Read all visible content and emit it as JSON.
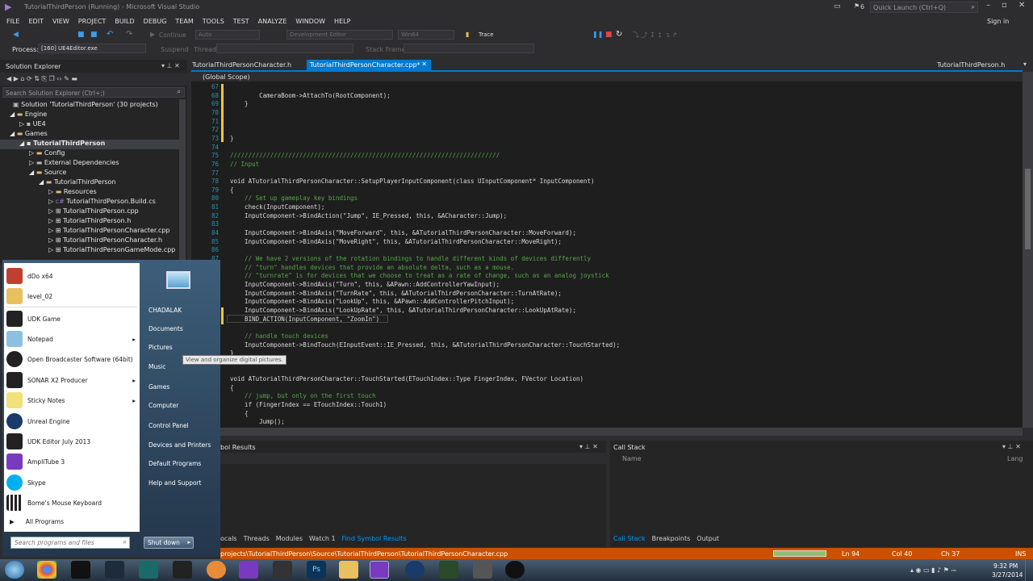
{
  "window": {
    "title": "TutorialThirdPerson (Running) - Microsoft Visual Studio",
    "notif_count": "6",
    "quick_launch": "Quick Launch (Ctrl+Q)",
    "sign_in": "Sign in"
  },
  "menu": [
    "FILE",
    "EDIT",
    "VIEW",
    "PROJECT",
    "BUILD",
    "DEBUG",
    "TEAM",
    "TOOLS",
    "TEST",
    "ANALYZE",
    "WINDOW",
    "HELP"
  ],
  "toolbar": {
    "continue": "Continue",
    "auto": "Auto",
    "config": "Development Editor",
    "platform": "Win64",
    "trace": "Trace",
    "process_label": "Process:",
    "process": "[160] UE4Editor.exe",
    "suspend": "Suspend",
    "thread": "Thread:",
    "stack_frame": "Stack Frame:"
  },
  "solution_explorer": {
    "title": "Solution Explorer",
    "search": "Search Solution Explorer (Ctrl+;)",
    "items": [
      "Solution 'TutorialThirdPerson' (30 projects)",
      "Engine",
      "UE4",
      "Games",
      "TutorialThirdPerson",
      "Config",
      "External Dependencies",
      "Source",
      "TutorialThirdPerson",
      "Resources",
      "TutorialThirdPerson.Build.cs",
      "TutorialThirdPerson.cpp",
      "TutorialThirdPerson.h",
      "TutorialThirdPersonCharacter.cpp",
      "TutorialThirdPersonCharacter.h",
      "TutorialThirdPersonGameMode.cpp"
    ]
  },
  "tabs": {
    "tab1": "TutorialThirdPersonCharacter.h",
    "tab2": "TutorialThirdPersonCharacter.cpp*",
    "right": "TutorialThirdPerson.h",
    "scope": "(Global Scope)"
  },
  "code": {
    "line_numbers": [
      "67",
      "68",
      "69",
      "70",
      "71",
      "72",
      "73",
      "74",
      "75",
      "76",
      "77",
      "78",
      "79",
      "80",
      "81",
      "82",
      "83",
      "84",
      "85",
      "86",
      "87",
      "88",
      "89",
      "90",
      "91",
      "92",
      "93",
      "94",
      "95",
      "96",
      "97",
      "98",
      "99",
      "100",
      "101",
      "102",
      "103",
      "104",
      "105",
      "106"
    ],
    "lines": [
      "",
      "        CameraBoom->AttachTo(RootComponent);",
      "    }",
      "",
      "",
      "",
      "}",
      "",
      "//////////////////////////////////////////////////////////////////////////",
      "// Input",
      "",
      "void ATutorialThirdPersonCharacter::SetupPlayerInputComponent(class UInputComponent* InputComponent)",
      "{",
      "    // Set up gameplay key bindings",
      "    check(InputComponent);",
      "    InputComponent->BindAction(\"Jump\", IE_Pressed, this, &ACharacter::Jump);",
      "",
      "    InputComponent->BindAxis(\"MoveForward\", this, &ATutorialThirdPersonCharacter::MoveForward);",
      "    InputComponent->BindAxis(\"MoveRight\", this, &ATutorialThirdPersonCharacter::MoveRight);",
      "",
      "    // We have 2 versions of the rotation bindings to handle different kinds of devices differently",
      "    // \"turn\" handles devices that provide an absolute delta, such as a mouse.",
      "    // \"turnrate\" is for devices that we choose to treat as a rate of change, such as an analog joystick",
      "    InputComponent->BindAxis(\"Turn\", this, &APawn::AddControllerYawInput);",
      "    InputComponent->BindAxis(\"TurnRate\", this, &ATutorialThirdPersonCharacter::TurnAtRate);",
      "    InputComponent->BindAxis(\"LookUp\", this, &APawn::AddControllerPitchInput);",
      "    InputComponent->BindAxis(\"LookUpRate\", this, &ATutorialThirdPersonCharacter::LookUpAtRate);",
      "    BIND_ACTION(InputComponent, \"ZoomIn\")",
      "",
      "    // handle touch devices",
      "    InputComponent->BindTouch(EInputEvent::IE_Pressed, this, &ATutorialThirdPersonCharacter::TouchStarted);",
      "}",
      "",
      "",
      "void ATutorialThirdPersonCharacter::TouchStarted(ETouchIndex::Type FingerIndex, FVector Location)",
      "{",
      "    // jump, but only on the first touch",
      "    if (FingerIndex == ETouchIndex::Touch1)",
      "    {",
      "        Jump();"
    ]
  },
  "bottom": {
    "symbol_results": "bol Results",
    "call_stack": "Call Stack",
    "name_col": "Name",
    "lang_col": "Lang",
    "left_tabs": [
      "ocals",
      "Threads",
      "Modules",
      "Watch 1",
      "Find Symbol Results"
    ],
    "right_tabs": [
      "Call Stack",
      "Breakpoints",
      "Output"
    ]
  },
  "status": {
    "path": "projects\\TutorialThirdPerson\\Source\\TutorialThirdPerson\\TutorialThirdPersonCharacter.cpp",
    "ln": "Ln 94",
    "col": "Col 40",
    "ch": "Ch 37",
    "ins": "INS"
  },
  "start_menu": {
    "programs": [
      "dDo x64",
      "level_02",
      "UDK Game",
      "Notepad",
      "Open Broadcaster Software (64bit)",
      "SONAR X2 Producer",
      "Sticky Notes",
      "Unreal Engine",
      "UDK Editor July 2013",
      "AmpliTube 3",
      "Skype",
      "Bome's Mouse Keyboard"
    ],
    "all_programs": "All Programs",
    "search": "Search programs and files",
    "right": [
      "CHADALAK",
      "Documents",
      "Pictures",
      "Music",
      "Games",
      "Computer",
      "Control Panel",
      "Devices and Printers",
      "Default Programs",
      "Help and Support"
    ],
    "tooltip": "View and organize digital pictures.",
    "shutdown": "Shut down"
  },
  "clock": {
    "time": "9:32 PM",
    "date": "3/27/2014"
  },
  "colors": {
    "vs_purple": "#68217a",
    "status_orange": "#ca5100",
    "accent_blue": "#007acc"
  }
}
